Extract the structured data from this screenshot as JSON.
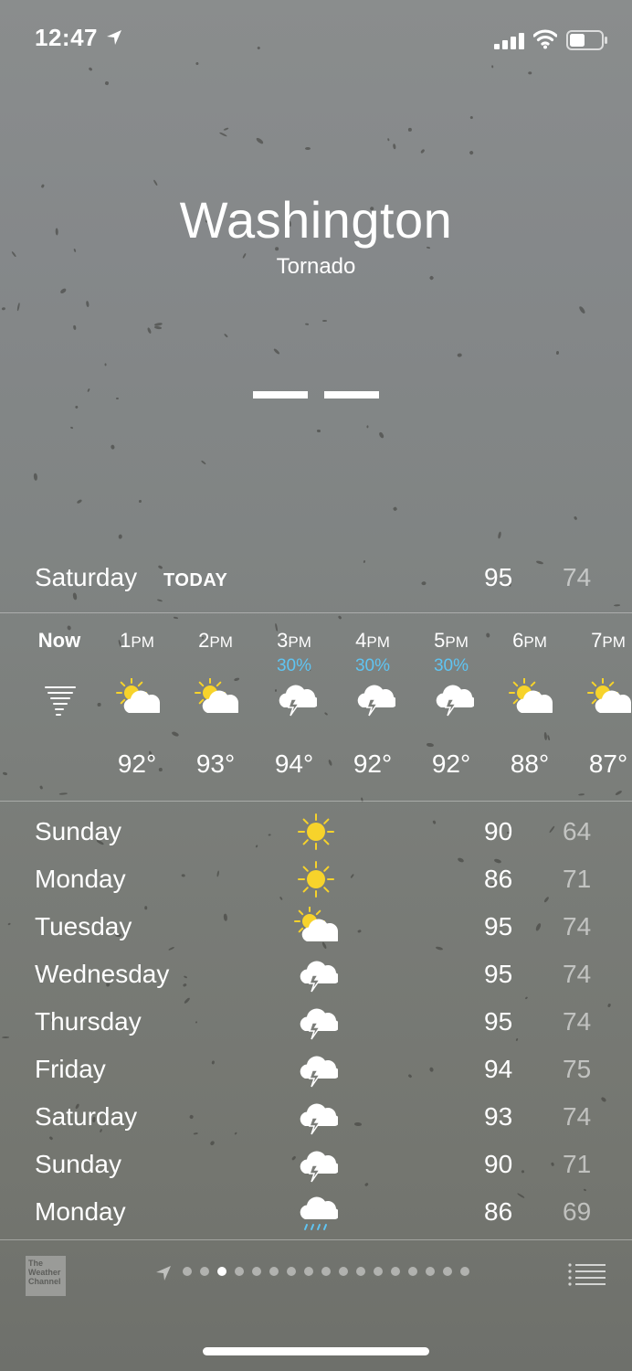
{
  "status_bar": {
    "time": "12:47"
  },
  "location": {
    "city": "Washington",
    "condition": "Tornado",
    "temperature": "— —"
  },
  "today": {
    "day": "Saturday",
    "tag": "TODAY",
    "high": "95",
    "low": "74"
  },
  "hourly": [
    {
      "label": "Now",
      "pct": "",
      "icon": "tornado-icon",
      "temp": ""
    },
    {
      "label": "1PM",
      "pct": "",
      "icon": "partly-sunny-icon",
      "temp": "92°"
    },
    {
      "label": "2PM",
      "pct": "",
      "icon": "partly-sunny-icon",
      "temp": "93°"
    },
    {
      "label": "3PM",
      "pct": "30%",
      "icon": "thunderstorm-icon",
      "temp": "94°"
    },
    {
      "label": "4PM",
      "pct": "30%",
      "icon": "thunderstorm-icon",
      "temp": "92°"
    },
    {
      "label": "5PM",
      "pct": "30%",
      "icon": "thunderstorm-icon",
      "temp": "92°"
    },
    {
      "label": "6PM",
      "pct": "",
      "icon": "partly-sunny-icon",
      "temp": "88°"
    },
    {
      "label": "7PM",
      "pct": "",
      "icon": "partly-sunny-icon",
      "temp": "87°"
    }
  ],
  "daily": [
    {
      "day": "Sunday",
      "icon": "sun-icon",
      "high": "90",
      "low": "64"
    },
    {
      "day": "Monday",
      "icon": "sun-icon",
      "high": "86",
      "low": "71"
    },
    {
      "day": "Tuesday",
      "icon": "partly-sunny-icon",
      "high": "95",
      "low": "74"
    },
    {
      "day": "Wednesday",
      "icon": "thunderstorm-icon",
      "high": "95",
      "low": "74"
    },
    {
      "day": "Thursday",
      "icon": "thunderstorm-icon",
      "high": "95",
      "low": "74"
    },
    {
      "day": "Friday",
      "icon": "thunderstorm-icon",
      "high": "94",
      "low": "75"
    },
    {
      "day": "Saturday",
      "icon": "thunderstorm-icon",
      "high": "93",
      "low": "74"
    },
    {
      "day": "Sunday",
      "icon": "thunderstorm-icon",
      "high": "90",
      "low": "71"
    },
    {
      "day": "Monday",
      "icon": "rain-icon",
      "high": "86",
      "low": "69"
    }
  ],
  "footer": {
    "provider_logo": "The Weather Channel",
    "page_count": 17,
    "active_page": 2
  },
  "colors": {
    "precip": "#5fc4f2",
    "sun": "#f7d32b"
  }
}
